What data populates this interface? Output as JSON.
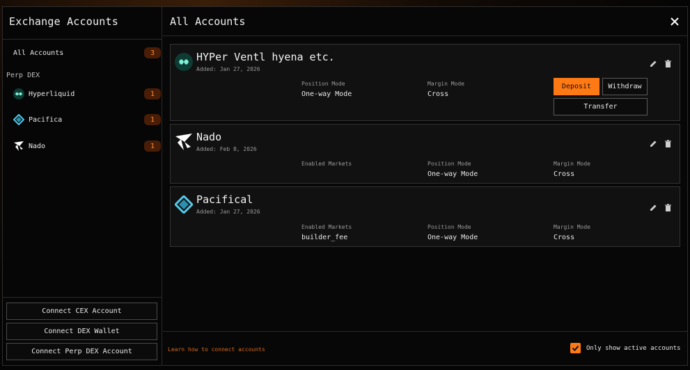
{
  "sidebar": {
    "title": "Exchange Accounts",
    "all_accounts": {
      "label": "All Accounts",
      "count": "3"
    },
    "section_label": "Perp DEX",
    "items": [
      {
        "label": "Hyperliquid",
        "count": "1",
        "icon": "hyperliquid-icon"
      },
      {
        "label": "Pacifica",
        "count": "1",
        "icon": "pacifica-icon"
      },
      {
        "label": "Nado",
        "count": "1",
        "icon": "nado-icon"
      }
    ],
    "buttons": {
      "connect_cex": "Connect CEX Account",
      "connect_dex_wallet": "Connect DEX Wallet",
      "connect_perp_dex": "Connect Perp DEX Account"
    }
  },
  "main": {
    "title": "All Accounts",
    "cards": [
      {
        "name": "HYPer Ventl hyena etc.",
        "added": "Added: Jan 27, 2026",
        "fields": [
          {
            "label": "Position Mode",
            "value": "One-way Mode"
          },
          {
            "label": "Margin Mode",
            "value": "Cross"
          }
        ],
        "buttons": {
          "deposit": "Deposit",
          "withdraw": "Withdraw",
          "transfer": "Transfer"
        }
      },
      {
        "name": "Nado",
        "added": "Added: Feb 8, 2026",
        "fields": [
          {
            "label": "Enabled Markets",
            "value": ""
          },
          {
            "label": "Position Mode",
            "value": "One-way Mode"
          },
          {
            "label": "Margin Mode",
            "value": "Cross"
          }
        ]
      },
      {
        "name": "Pacifical",
        "added": "Added: Jan 27, 2026",
        "fields": [
          {
            "label": "Enabled Markets",
            "value": "builder_fee"
          },
          {
            "label": "Position Mode",
            "value": "One-way Mode"
          },
          {
            "label": "Margin Mode",
            "value": "Cross"
          }
        ]
      }
    ],
    "footer": {
      "learn_link": "Learn how to connect accounts",
      "only_active_label": "Only show active accounts",
      "only_active_checked": true
    }
  },
  "colors": {
    "accent": "#ff7a14",
    "badge_bg": "#4a1d07",
    "badge_text": "#ff8c2e",
    "link": "#d2691e"
  }
}
